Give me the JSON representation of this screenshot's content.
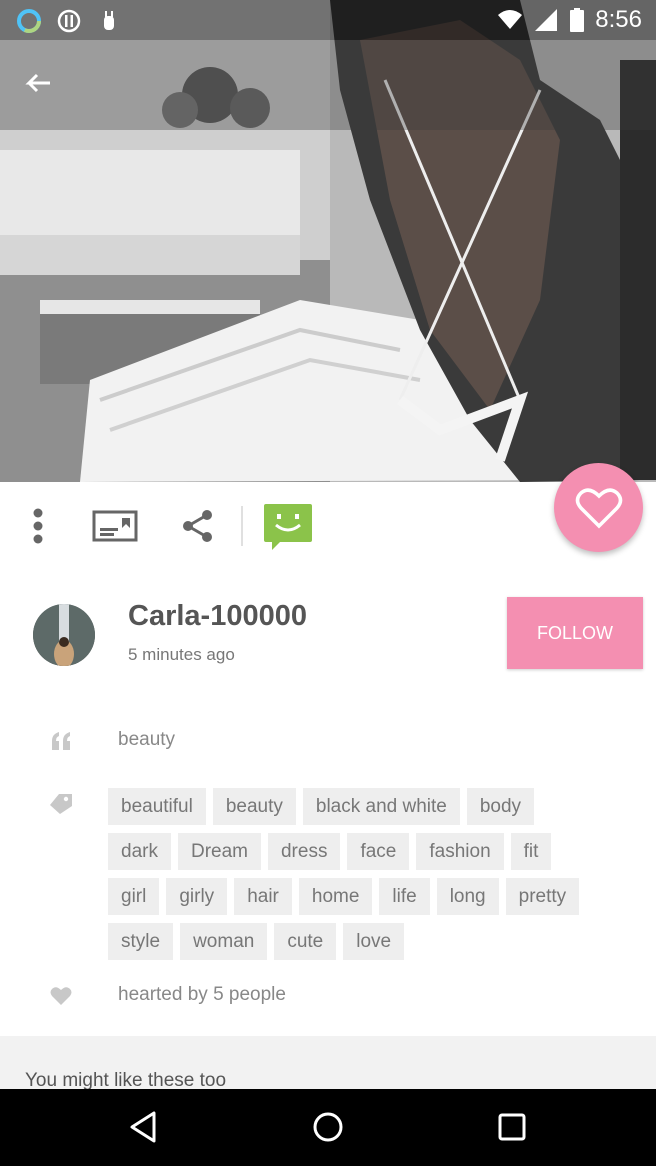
{
  "status_bar": {
    "time": "8:56",
    "left_icons": [
      "ring-app-icon",
      "info-circle-icon",
      "android-debug-icon"
    ],
    "right_icons": [
      "wifi-icon",
      "signal-icon",
      "battery-icon"
    ]
  },
  "header": {
    "back_icon": "arrow-back-icon"
  },
  "actions": {
    "more_icon": "more-vert-icon",
    "pin_icon": "board-icon",
    "share_icon": "share-icon",
    "comment_icon": "smiley-chat-icon",
    "heart_icon": "heart-outline-icon"
  },
  "author": {
    "name": "Carla-100000",
    "time_ago": "5 minutes ago",
    "follow_label": "FOLLOW"
  },
  "post": {
    "description": "beauty",
    "tags": [
      "beautiful",
      "beauty",
      "black and white",
      "body",
      "dark",
      "Dream",
      "dress",
      "face",
      "fashion",
      "fit",
      "girl",
      "girly",
      "hair",
      "home",
      "life",
      "long",
      "pretty",
      "style",
      "woman",
      "cute",
      "love"
    ],
    "hearted_by": "hearted by 5 people"
  },
  "related": {
    "title": "You might like these too"
  },
  "colors": {
    "accent_pink": "#f48fb1",
    "chat_green": "#8bc34a"
  }
}
